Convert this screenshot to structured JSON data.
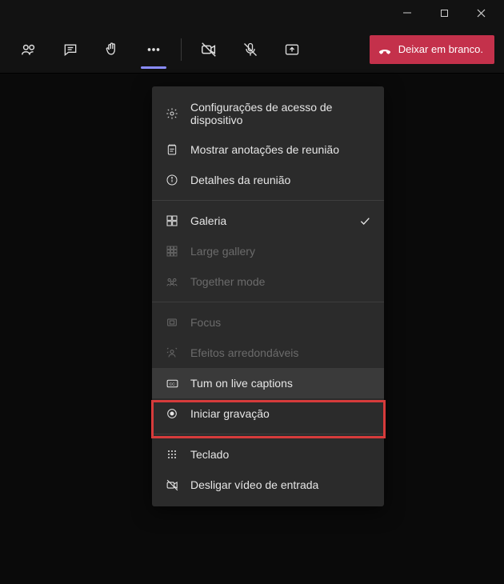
{
  "window": {
    "minimize": "–",
    "maximize": "▢",
    "close": "✕"
  },
  "toolbar": {
    "people_icon": "people",
    "chat_icon": "chat",
    "hand_icon": "raise hand",
    "more_icon": "more",
    "camera_icon": "camera off",
    "mic_icon": "mic off",
    "share_icon": "share",
    "leave_label": "Deixar em branco."
  },
  "menu": {
    "device_settings": "Configurações de acesso de dispositivo",
    "meeting_notes": "Mostrar anotações de reunião",
    "meeting_details": "Detalhes da reunião",
    "gallery": "Galeria",
    "large_gallery": "Large gallery",
    "together_mode": "Together mode",
    "focus": "Focus",
    "background_effects": "Efeitos arredondáveis",
    "live_captions": "Tum on live captions",
    "start_recording": "Iniciar gravação",
    "keypad": "Teclado",
    "turn_off_incoming_video": "Desligar vídeo de entrada"
  },
  "colors": {
    "leave_button": "#c4314b",
    "accent": "#8a8cff",
    "highlight": "#d63b3b"
  }
}
